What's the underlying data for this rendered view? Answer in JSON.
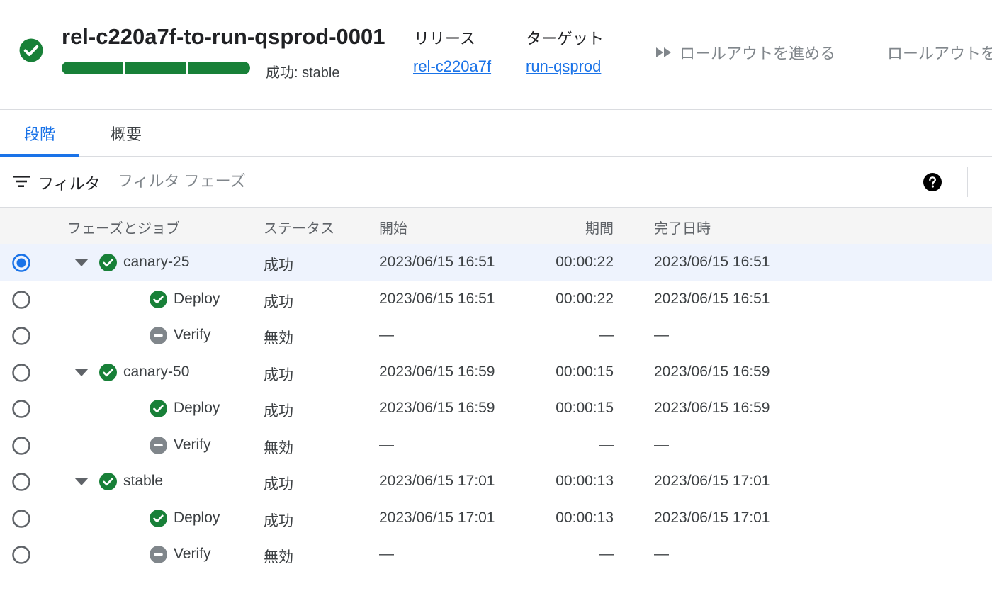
{
  "header": {
    "title": "rel-c220a7f-to-run-qsprod-0001",
    "status_text": "成功: stable",
    "progress_segments": [
      "succeeded",
      "succeeded",
      "succeeded"
    ],
    "release_label": "リリース",
    "release_value": "rel-c220a7f",
    "target_label": "ターゲット",
    "target_value": "run-qsprod",
    "advance_action": "ロールアウトを進める",
    "second_action": "ロールアウトを"
  },
  "tabs": [
    {
      "label": "段階",
      "active": true
    },
    {
      "label": "概要",
      "active": false
    }
  ],
  "filter": {
    "label": "フィルタ",
    "placeholder": "フィルタ フェーズ"
  },
  "table": {
    "columns": {
      "name": "フェーズとジョブ",
      "status": "ステータス",
      "start": "開始",
      "duration": "期間",
      "completed": "完了日時"
    },
    "rows": [
      {
        "type": "phase",
        "name": "canary-25",
        "icon": "check-circle-icon",
        "status": "成功",
        "start": "2023/06/15 16:51",
        "duration": "00:00:22",
        "completed": "2023/06/15 16:51",
        "selected": true
      },
      {
        "type": "job",
        "name": "Deploy",
        "icon": "check-circle-icon",
        "status": "成功",
        "start": "2023/06/15 16:51",
        "duration": "00:00:22",
        "completed": "2023/06/15 16:51",
        "selected": false
      },
      {
        "type": "job",
        "name": "Verify",
        "icon": "disabled-circle-icon",
        "status": "無効",
        "start": "—",
        "duration": "—",
        "completed": "—",
        "selected": false
      },
      {
        "type": "phase",
        "name": "canary-50",
        "icon": "check-circle-icon",
        "status": "成功",
        "start": "2023/06/15 16:59",
        "duration": "00:00:15",
        "completed": "2023/06/15 16:59",
        "selected": false
      },
      {
        "type": "job",
        "name": "Deploy",
        "icon": "check-circle-icon",
        "status": "成功",
        "start": "2023/06/15 16:59",
        "duration": "00:00:15",
        "completed": "2023/06/15 16:59",
        "selected": false
      },
      {
        "type": "job",
        "name": "Verify",
        "icon": "disabled-circle-icon",
        "status": "無効",
        "start": "—",
        "duration": "—",
        "completed": "—",
        "selected": false
      },
      {
        "type": "phase",
        "name": "stable",
        "icon": "check-circle-icon",
        "status": "成功",
        "start": "2023/06/15 17:01",
        "duration": "00:00:13",
        "completed": "2023/06/15 17:01",
        "selected": false
      },
      {
        "type": "job",
        "name": "Deploy",
        "icon": "check-circle-icon",
        "status": "成功",
        "start": "2023/06/15 17:01",
        "duration": "00:00:13",
        "completed": "2023/06/15 17:01",
        "selected": false
      },
      {
        "type": "job",
        "name": "Verify",
        "icon": "disabled-circle-icon",
        "status": "無効",
        "start": "—",
        "duration": "—",
        "completed": "—",
        "selected": false
      }
    ]
  },
  "colors": {
    "success": "#188038",
    "accent": "#1a73e8",
    "disabled": "#80868b"
  }
}
